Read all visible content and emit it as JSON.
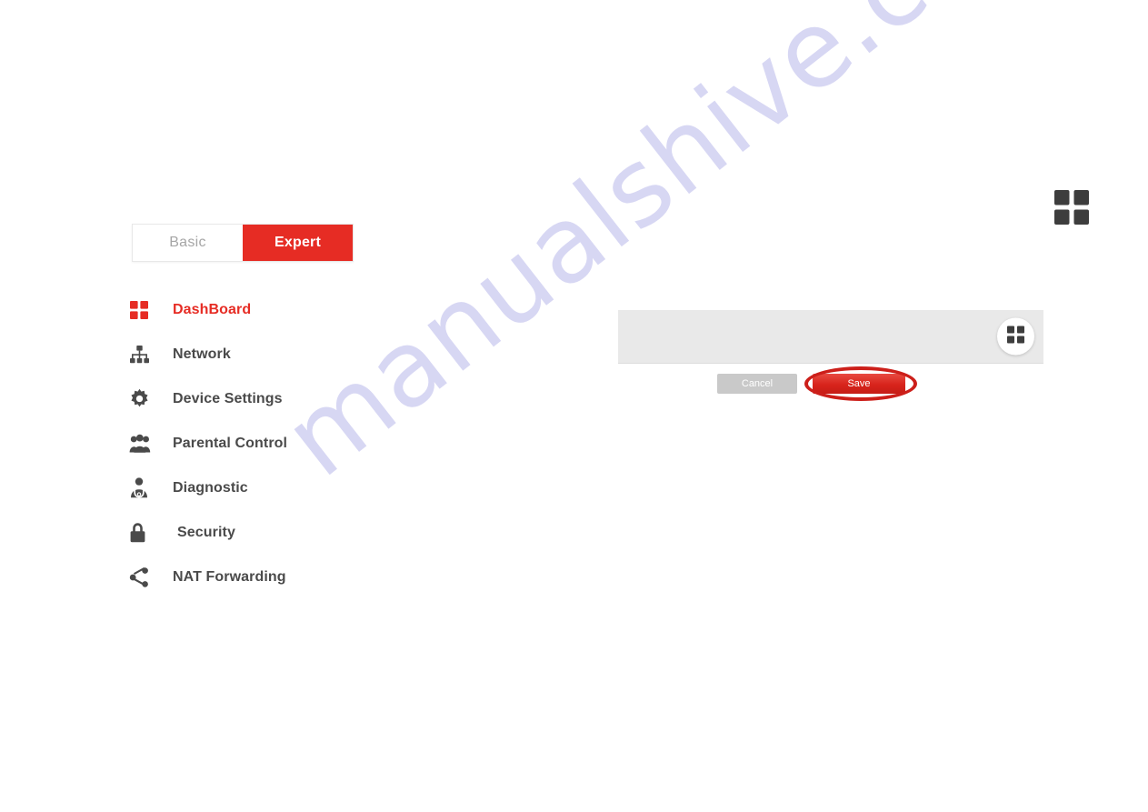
{
  "mode_toggle": {
    "basic_label": "Basic",
    "expert_label": "Expert",
    "active": "Expert",
    "active_color": "#e62c24"
  },
  "sidebar": {
    "items": [
      {
        "label": "DashBoard",
        "icon": "grid-icon",
        "active": true
      },
      {
        "label": "Network",
        "icon": "sitemap-icon",
        "active": false
      },
      {
        "label": "Device Settings",
        "icon": "gear-icon",
        "active": false
      },
      {
        "label": "Parental Control",
        "icon": "users-icon",
        "active": false
      },
      {
        "label": "Diagnostic",
        "icon": "doctor-icon",
        "active": false
      },
      {
        "label": "Security",
        "icon": "lock-icon",
        "active": false
      },
      {
        "label": "NAT Forwarding",
        "icon": "share-icon",
        "active": false
      }
    ]
  },
  "header": {
    "grid_icon": "grid-icon"
  },
  "panel": {
    "grid_button_icon": "grid-icon"
  },
  "actions": {
    "cancel_label": "Cancel",
    "save_label": "Save",
    "save_highlighted": true,
    "annotation_color": "#cc1f1a"
  },
  "watermark": {
    "text": "manualshive.com",
    "color": "#c9c8ef"
  }
}
